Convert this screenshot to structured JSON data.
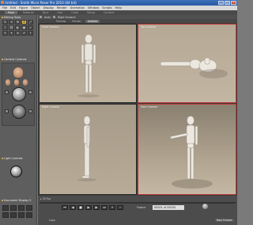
{
  "window": {
    "title": "Untitled - Smith Micro Poser Pro 2010 (64 bit)",
    "min_label": "_",
    "max_label": "□",
    "close_label": "×"
  },
  "menu": [
    "File",
    "Edit",
    "Figure",
    "Object",
    "Display",
    "Render",
    "Animation",
    "Window",
    "Scripts",
    "Help"
  ],
  "room_tabs": [
    {
      "label": "Pose",
      "active": true
    },
    {
      "label": "Material",
      "active": false
    },
    {
      "label": "Face",
      "active": false
    },
    {
      "label": "Hair",
      "active": false
    },
    {
      "label": "Cloth",
      "active": false
    },
    {
      "label": "Setup",
      "active": false
    },
    {
      "label": "Content",
      "active": false
    }
  ],
  "left_panel": {
    "editing_tools": "Editing Tools",
    "camera_controls": "Camera Controls",
    "light_controls": "Light Controls",
    "document_display": "Document Display S"
  },
  "viewport_toolbar": {
    "first": "Andy",
    "second": "Right Forearm"
  },
  "viewport_tabs": [
    {
      "label": "Preview",
      "active": false
    },
    {
      "label": "Render",
      "active": false
    },
    {
      "label": "Untitled",
      "active": true
    }
  ],
  "viewports": {
    "front": "Front Camera",
    "top": "Top Camera",
    "right": "Right Camera",
    "main": "Main Camera"
  },
  "bottom_bar": {
    "label": "▸ 30 Fps",
    "frame_label": "Frame:",
    "frame_value": "00001 of 00030",
    "loop_label": "Loop",
    "new_frames": "New Frames"
  }
}
